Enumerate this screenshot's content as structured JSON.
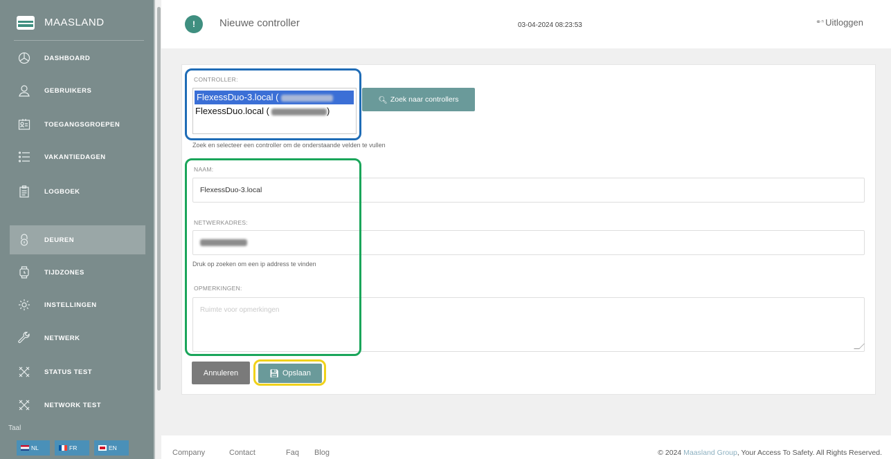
{
  "sidebar": {
    "brand": "MAASLAND",
    "items": [
      {
        "label": "DASHBOARD",
        "icon": "pie-chart-icon"
      },
      {
        "label": "GEBRUIKERS",
        "icon": "user-icon"
      },
      {
        "label": "TOEGANGSGROEPEN",
        "icon": "id-card-icon"
      },
      {
        "label": "VAKANTIEDAGEN",
        "icon": "list-icon"
      },
      {
        "label": "LOGBOEK",
        "icon": "clipboard-icon"
      },
      {
        "label": "DEUREN",
        "icon": "lock-icon",
        "active": true
      },
      {
        "label": "TIJDZONES",
        "icon": "watch-icon"
      },
      {
        "label": "INSTELLINGEN",
        "icon": "gear-icon"
      },
      {
        "label": "NETWERK",
        "icon": "wrench-icon"
      },
      {
        "label": "STATUS TEST",
        "icon": "tools-icon"
      },
      {
        "label": "NETWORK TEST",
        "icon": "tools-icon"
      }
    ],
    "language_label": "Taal",
    "languages": [
      "NL",
      "FR",
      "EN"
    ]
  },
  "header": {
    "badge": "!",
    "title": "Nieuwe controller",
    "datetime": "03-04-2024 08:23:53",
    "logout": "Uitloggen"
  },
  "form": {
    "controller_label": "CONTROLLER:",
    "controller_options": [
      "FlexessDuo-3.local (",
      "FlexessDuo.local ("
    ],
    "controller_closing": ")",
    "search_button": "Zoek naar controllers",
    "controller_hint": "Zoek en selecteer een controller om de onderstaande velden te vullen",
    "name_label": "NAAM:",
    "name_value": "FlexessDuo-3.local",
    "address_label": "NETWERKADRES:",
    "address_hint": "Druk op zoeken om een ip address te vinden",
    "notes_label": "OPMERKINGEN:",
    "notes_placeholder": "Ruimte voor opmerkingen",
    "cancel_button": "Annuleren",
    "save_button": "Opslaan"
  },
  "footer": {
    "links": [
      "Company",
      "Contact",
      "Faq",
      "Blog"
    ],
    "copyright_prefix": "© 2024 ",
    "copyright_brand": "Maasland Group",
    "copyright_suffix": ", Your Access To Safety. All Rights Reserved."
  },
  "colors": {
    "sidebar": "#7b8c8c",
    "accent": "#3f8f80",
    "button": "#6a9a9a",
    "highlight_blue": "#1f6cb6",
    "highlight_green": "#1aa55a",
    "highlight_yellow": "#f0d21a"
  }
}
